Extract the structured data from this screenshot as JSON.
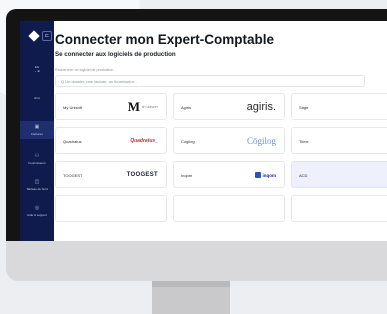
{
  "page": {
    "title": "Connecter mon Expert-Comptable",
    "subtitle": "Se connecter aux logiciels de production",
    "field_label": "Rechercher un logiciel de production",
    "search_placeholder": "Q  Un dossier, une facture, un fournisseur..."
  },
  "sidebar": {
    "badge": "EG",
    "badge_sub": "⌄ ⊕",
    "toggles": "⊞  ⊟",
    "items": [
      {
        "label": "Factures",
        "icon": "invoice-icon"
      },
      {
        "label": "Fournisseurs",
        "icon": "people-icon"
      },
      {
        "label": "Tableau de bord",
        "icon": "dashboard-icon"
      },
      {
        "label": "Aide & support",
        "icon": "help-icon"
      }
    ]
  },
  "software": [
    {
      "name": "My Unisoft",
      "logo": "M",
      "logo_sub": "MY UNISOFT"
    },
    {
      "name": "Agiris",
      "logo": "agiris."
    },
    {
      "name": "Sage",
      "logo": ""
    },
    {
      "name": "Quadratus",
      "logo": "Quadratus_"
    },
    {
      "name": "Cogilog",
      "logo": "Cōgilog"
    },
    {
      "name": "Tiime",
      "logo": ""
    },
    {
      "name": "TOOGEST",
      "logo": "TOOGEST"
    },
    {
      "name": "Inqom",
      "logo": "inqom"
    },
    {
      "name": "ACD",
      "logo": ""
    }
  ],
  "colors": {
    "sidebar_bg": "#0f1b4c",
    "highlight": "#eef1fb",
    "quadratus_red": "#d7263d",
    "inqom_blue": "#2a52be"
  }
}
